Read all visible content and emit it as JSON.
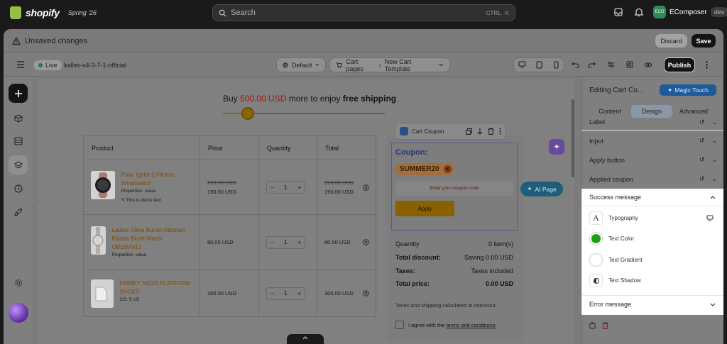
{
  "topbar": {
    "brand": "shopify",
    "edition": "Spring '26",
    "search_placeholder": "Search",
    "shortcut_ctrl": "CTRL",
    "shortcut_key": "K",
    "store_avatar": "ECO",
    "store_name": "EComposer",
    "store_badge": "dev"
  },
  "unsaved": {
    "title": "Unsaved changes",
    "discard": "Discard",
    "save": "Save"
  },
  "toolbar": {
    "live": "Live",
    "theme_name": "kalles-v4-3-7-1-official",
    "locale": "Default",
    "page_type": "Cart pages",
    "template": "New Cart Template",
    "publish": "Publish"
  },
  "canvas": {
    "shipping": {
      "pre": "Buy ",
      "amount": "500.00 USD",
      "mid": " more to enjoy ",
      "bold": "free shipping"
    },
    "progress_percent": 16,
    "table": {
      "headers": [
        "Product",
        "Price",
        "Quantity",
        "Total"
      ],
      "rows": [
        {
          "name": "Polar Ignite 2 Fitness Smartwatch",
          "props": "Properties: value",
          "note": "This is demo text",
          "price_old": "250.00 USD",
          "price": "190.00 USD",
          "qty": "1",
          "total_old": "250.00 USD",
          "total": "190.00 USD"
        },
        {
          "name": "Ladies Olivia Burton Abstract Florals Blush Watch OB16VM12",
          "props": "Properties: value",
          "note": "",
          "price_old": "",
          "price": "80.00 USD",
          "qty": "1",
          "total_old": "",
          "total": "80.00 USD"
        },
        {
          "name": "DISNEY NIZZA PLATFORM SHOES",
          "props": "CÖ: 5 US",
          "note": "",
          "price_old": "",
          "price": "100.00 USD",
          "qty": "1",
          "total_old": "",
          "total": "100.00 USD"
        }
      ],
      "minus": "−",
      "plus": "+"
    },
    "element_toolbar": {
      "label": "Cart Coupon"
    },
    "coupon": {
      "title": "Coupon:",
      "code": "SUMMER20",
      "placeholder": "Enter your coupon code",
      "apply": "Apply"
    },
    "ai_page": "AI Page",
    "summary": [
      {
        "label": "Quantity",
        "value": "0 item(s)"
      },
      {
        "label": "Total discount:",
        "value": "Saving 0.00 USD"
      },
      {
        "label": "Taxes:",
        "value": "Taxes included"
      },
      {
        "label": "Total price:",
        "value": "0.00 USD"
      }
    ],
    "note": "Taxes and shipping calculated at checkout",
    "agree_pre": "I agree with the ",
    "agree_link": "terms and conditions",
    "agree_post": "."
  },
  "panel": {
    "title": "Editing Cart Co...",
    "magic_touch": "Magic Touch",
    "tabs": [
      "Content",
      "Design",
      "Advanced"
    ],
    "active_tab": "Design",
    "sections": [
      "Label",
      "Input",
      "Apply button",
      "Applied coupon"
    ],
    "success": {
      "title": "Success message",
      "items": [
        "Typography",
        "Text Color",
        "Text Gradient",
        "Text Shadow"
      ],
      "text_color": "#1aa31a"
    },
    "error_title": "Error message"
  },
  "colors": {
    "accent_brand": "#95bf47",
    "coupon_title": "#23357a",
    "apply_button": "#c88a00"
  }
}
